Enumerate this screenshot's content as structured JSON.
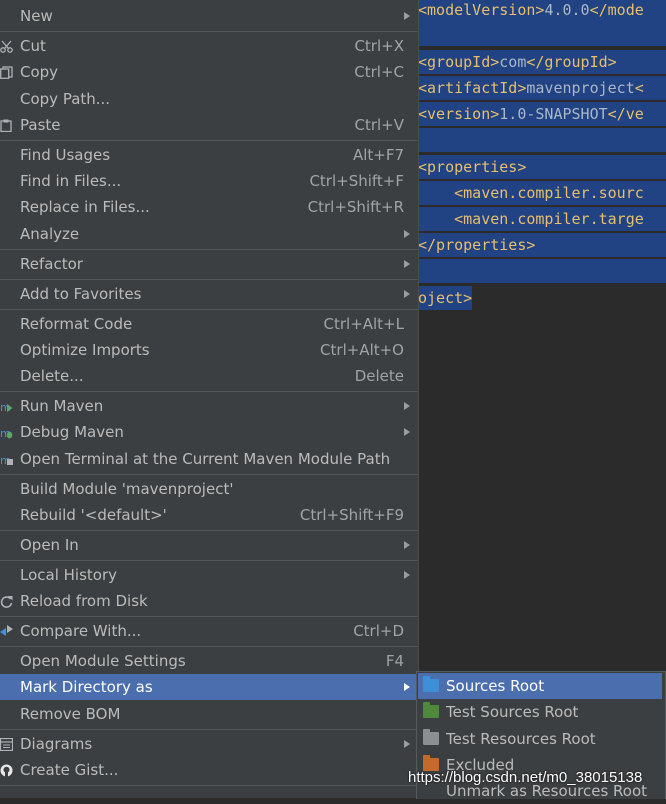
{
  "editor": {
    "lines": [
      {
        "tag_open": "<modelVersion>",
        "text": "4.0.0",
        "tag_close": "</mode"
      },
      {
        "tag_open": "<groupId>",
        "text": "com",
        "tag_close": "</groupId>"
      },
      {
        "tag_open": "<artifactId>",
        "text": "mavenproject",
        "tag_close": "<"
      },
      {
        "tag_open": "<version>",
        "text": "1.0-SNAPSHOT",
        "tag_close": "</ve"
      },
      {
        "tag_open": "<properties>",
        "text": "",
        "tag_close": ""
      },
      {
        "tag_open": "    <maven.compiler.sourc",
        "text": "",
        "tag_close": ""
      },
      {
        "tag_open": "    <maven.compiler.targe",
        "text": "",
        "tag_close": ""
      },
      {
        "tag_open": "</properties>",
        "text": "",
        "tag_close": ""
      },
      {
        "tag_open": "oject>",
        "text": "",
        "tag_close": ""
      }
    ]
  },
  "menu": {
    "new": "New",
    "cut": "Cut",
    "cut_sc": "Ctrl+X",
    "copy": "Copy",
    "copy_sc": "Ctrl+C",
    "copy_path": "Copy Path...",
    "paste": "Paste",
    "paste_sc": "Ctrl+V",
    "find_usages": "Find Usages",
    "find_usages_sc": "Alt+F7",
    "find_in_files": "Find in Files...",
    "find_in_files_sc": "Ctrl+Shift+F",
    "replace_in_files": "Replace in Files...",
    "replace_in_files_sc": "Ctrl+Shift+R",
    "analyze": "Analyze",
    "refactor": "Refactor",
    "add_to_favorites": "Add to Favorites",
    "reformat_code": "Reformat Code",
    "reformat_code_sc": "Ctrl+Alt+L",
    "optimize_imports": "Optimize Imports",
    "optimize_imports_sc": "Ctrl+Alt+O",
    "delete": "Delete...",
    "delete_sc": "Delete",
    "run_maven": "Run Maven",
    "debug_maven": "Debug Maven",
    "open_terminal": "Open Terminal at the Current Maven Module Path",
    "build_module": "Build Module 'mavenproject'",
    "rebuild": "Rebuild '<default>'",
    "rebuild_sc": "Ctrl+Shift+F9",
    "open_in": "Open In",
    "local_history": "Local History",
    "reload_from_disk": "Reload from Disk",
    "compare_with": "Compare With...",
    "compare_with_sc": "Ctrl+D",
    "open_module_settings": "Open Module Settings",
    "open_module_settings_sc": "F4",
    "mark_directory_as": "Mark Directory as",
    "remove_bom": "Remove BOM",
    "diagrams": "Diagrams",
    "create_gist": "Create Gist..."
  },
  "submenu": {
    "sources_root": "Sources Root",
    "test_sources_root": "Test Sources Root",
    "test_resources_root": "Test Resources Root",
    "excluded": "Excluded",
    "unmark": "Unmark as Resources Root"
  },
  "watermark": "https://blog.csdn.net/m0_38015138",
  "colors": {
    "menu_bg": "#3c3f41",
    "highlight": "#4b6eaf",
    "selection": "#214283",
    "sources_folder": "#3d8fd6",
    "test_folder": "#4f8a3c",
    "excluded_folder": "#c46a2b"
  }
}
